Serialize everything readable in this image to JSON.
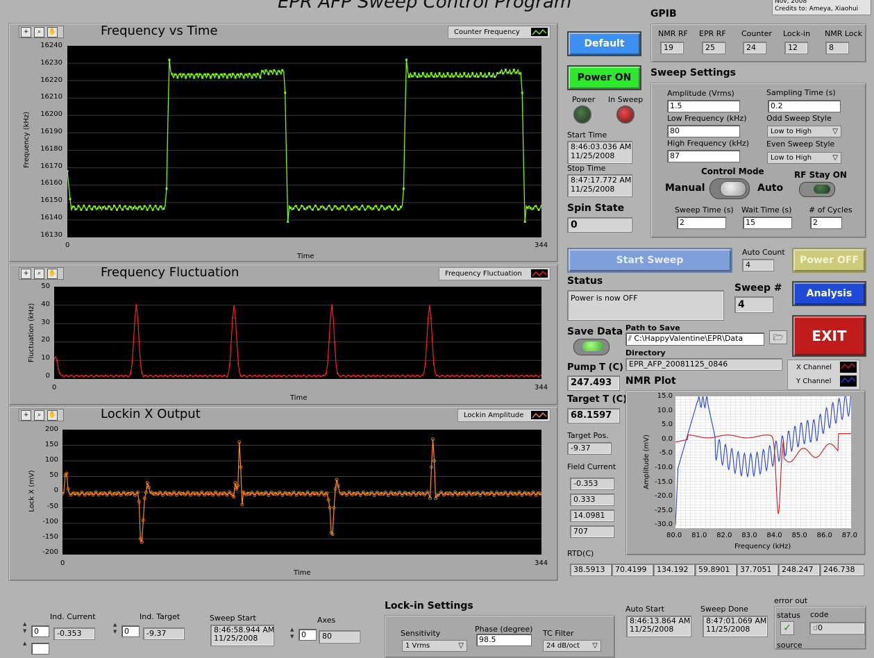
{
  "window": {
    "title": "EPR AFP Sweep Control Program",
    "credits_line1": "Nov, 2008",
    "credits_line2": "Credits to: Ameya, Xiaohui"
  },
  "graph1": {
    "title": "Frequency vs Time",
    "legend": "Counter Frequency",
    "ylabel": "Frequency (kHz)",
    "xlabel": "Time",
    "yticks": [
      "16240",
      "16230",
      "16220",
      "16210",
      "16200",
      "16190",
      "16180",
      "16170",
      "16160",
      "16150",
      "16140",
      "16130"
    ],
    "xticks": [
      "0",
      "344"
    ],
    "color": "#7CFC00"
  },
  "graph2": {
    "title": "Frequency Fluctuation",
    "legend": "Frequency Fluctuation",
    "ylabel": "Fluctuation (kHz)",
    "xlabel": "Time",
    "yticks": [
      "50",
      "40",
      "30",
      "20",
      "10",
      "0"
    ],
    "xticks": [
      "0",
      "344"
    ],
    "color": "#FF2020"
  },
  "graph3": {
    "title": "Lockin X Output",
    "legend": "Lockin Amplitude",
    "ylabel": "Lock X (mV)",
    "xlabel": "Time",
    "yticks": [
      "200",
      "150",
      "100",
      "50",
      "0",
      "-50",
      "-100",
      "-150",
      "-200"
    ],
    "xticks": [
      "0",
      "344"
    ],
    "color": "#FF8C1A"
  },
  "buttons": {
    "default": "Default",
    "power_on": "Power ON",
    "start_sweep": "Start Sweep",
    "power_off": "Power OFF",
    "analysis": "Analysis",
    "exit": "EXIT"
  },
  "leds": {
    "power": "Power",
    "in_sweep": "In Sweep"
  },
  "times": {
    "start_label": "Start Time",
    "start_time": "8:46:03.036 AM",
    "start_date": "11/25/2008",
    "stop_label": "Stop Time",
    "stop_time": "8:47:17.772 AM",
    "stop_date": "11/25/2008"
  },
  "spin_state": {
    "label": "Spin State",
    "value": "0"
  },
  "gpib": {
    "title": "GPIB",
    "items": [
      {
        "label": "NMR RF",
        "value": "19"
      },
      {
        "label": "EPR RF",
        "value": "25"
      },
      {
        "label": "Counter",
        "value": "24"
      },
      {
        "label": "Lock-in",
        "value": "12"
      },
      {
        "label": "NMR Lock",
        "value": "8"
      }
    ]
  },
  "sweep_settings": {
    "title": "Sweep Settings",
    "amplitude_label": "Amplitude (Vrms)",
    "amplitude": "1.5",
    "sampling_label": "Sampling Time (s)",
    "sampling": "0.2",
    "low_freq_label": "Low Frequency (kHz)",
    "low_freq": "80",
    "odd_style_label": "Odd Sweep Style",
    "odd_style": "Low to High",
    "high_freq_label": "High Frequency (kHz)",
    "high_freq": "87",
    "even_style_label": "Even Sweep Style",
    "even_style": "Low to High",
    "control_mode_label": "Control Mode",
    "manual": "Manual",
    "auto": "Auto",
    "rf_stay_label": "RF Stay ON",
    "sweep_time_label": "Sweep Time (s)",
    "sweep_time": "2",
    "wait_time_label": "Wait Time (s)",
    "wait_time": "15",
    "cycles_label": "# of Cycles",
    "cycles": "2"
  },
  "auto_count": {
    "label": "Auto Count",
    "value": "4"
  },
  "status": {
    "label": "Status",
    "value": "Power is now OFF"
  },
  "sweep_num": {
    "label": "Sweep #",
    "value": "4"
  },
  "save": {
    "label": "Save Data",
    "path_label": "Path to Save",
    "path": "C:\\HappyValentine\\EPR\\Data",
    "dir_label": "Directory",
    "dir": "EPR_AFP_20081125_0846"
  },
  "pump_t": {
    "label": "Pump T (C)",
    "value": "247.493"
  },
  "target_t": {
    "label": "Target T (C)",
    "value": "68.1597"
  },
  "target_pos": {
    "label": "Target Pos.",
    "value": "-9.37"
  },
  "field_current": {
    "label": "Field Current",
    "values": [
      "-0.353",
      "0.333",
      "14.0981",
      "707"
    ]
  },
  "nmr": {
    "title": "NMR Plot",
    "legend_x": "X Channel",
    "legend_y": "Y Channel",
    "ylabel": "Amplitude (mV)",
    "xlabel": "Frequency (kHz)",
    "yticks": [
      "15.0",
      "10.0",
      "5.0",
      "0.0",
      "-5.0",
      "-10.0",
      "-15.0",
      "-20.0",
      "-25.0",
      "-30.0"
    ],
    "xticks": [
      "80.0",
      "81.0",
      "82.0",
      "83.0",
      "84.0",
      "85.0",
      "86.0",
      "87.0"
    ],
    "x_color": "#D01818",
    "y_color": "#2040E0"
  },
  "rtd": {
    "label": "RTD(C)",
    "values": [
      "38.5913",
      "70.4199",
      "134.192",
      "59.8901",
      "37.7051",
      "248.247",
      "246.738"
    ]
  },
  "bottom": {
    "ind_current_label": "Ind. Current",
    "ind_current_step": "0",
    "ind_current": "-0.353",
    "ind_target_label": "Ind. Target",
    "ind_target_step": "0",
    "ind_target": "-9.37",
    "sweep_start_label": "Sweep Start",
    "sweep_start_time": "8:46:58.944 AM",
    "sweep_start_date": "11/25/2008",
    "axes_label": "Axes",
    "axes_step": "0",
    "axes": "80",
    "lockin_title": "Lock-in Settings",
    "sensitivity_label": "Sensitivity",
    "sensitivity": "1 Vrms",
    "phase_label": "Phase (degree)",
    "phase": "98.5",
    "tc_label": "TC Filter",
    "tc": "24 dB/oct",
    "auto_start_label": "Auto Start",
    "auto_start_time": "8:46:13.864 AM",
    "auto_start_date": "11/25/2008",
    "sweep_done_label": "Sweep Done",
    "sweep_done_time": "8:47:01.069 AM",
    "sweep_done_date": "11/25/2008",
    "error_out_label": "error out",
    "status_label": "status",
    "code_label": "code",
    "code": "0",
    "source_label": "source"
  }
}
